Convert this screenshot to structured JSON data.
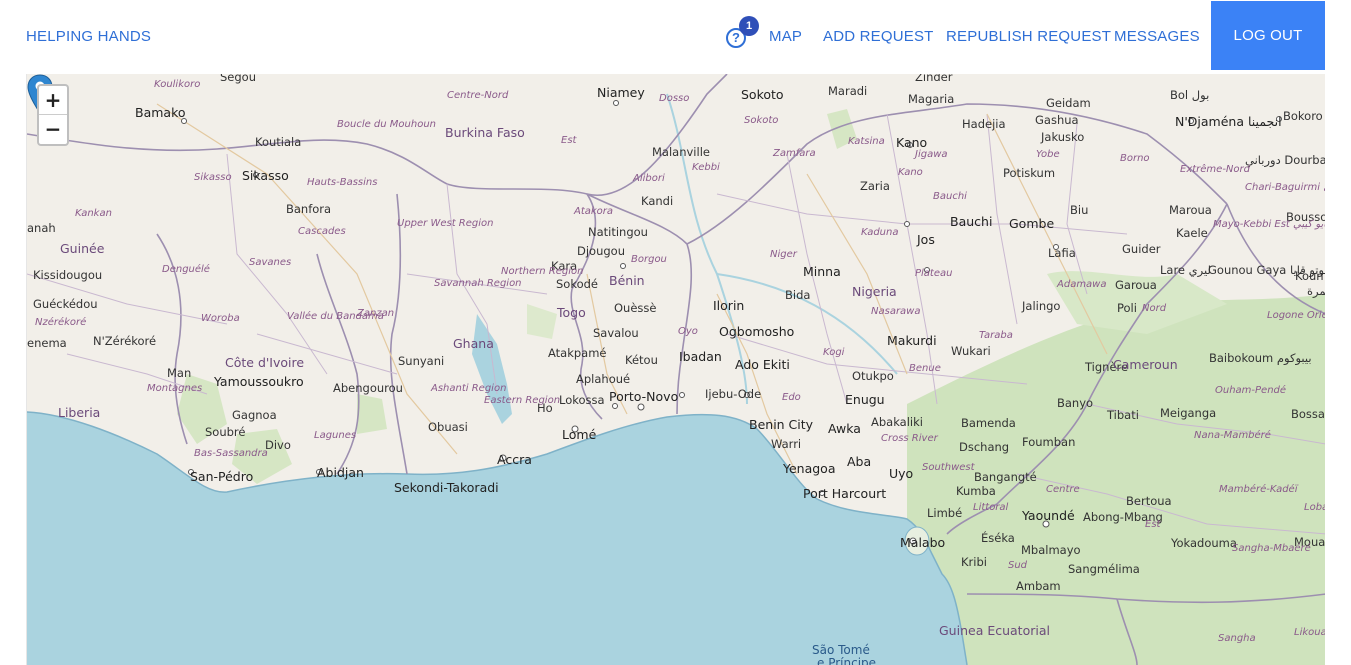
{
  "navbar": {
    "brand": "HELPING HANDS",
    "help_icon": "question-circle-icon",
    "notification_count": "1",
    "links": {
      "map": "MAP",
      "add_request": "ADD REQUEST",
      "republish_request": "REPUBLISH REQUEST",
      "messages": "MESSAGES"
    },
    "logout": "LOG OUT",
    "accent_color": "#3b82f6"
  },
  "map": {
    "zoom_in": "+",
    "zoom_out": "−",
    "marker_icon": "map-pin-icon",
    "labels": {
      "zinder": "Zinder",
      "segou": "Ségou",
      "koulikoro": "Koulikoro",
      "centre_nord": "Centre-Nord",
      "niamey": "Niamey",
      "dosso": "Dosso",
      "sokoto": "Sokoto",
      "maradi": "Maradi",
      "magaria": "Magaria",
      "geidam": "Geidam",
      "bol": "Bol بول",
      "bokoro": "Bokoro بوكورو",
      "ndjamena": "N'Djaména انجمينا",
      "bamako": "Bamako",
      "koutiala": "Koutiala",
      "boucle": "Boucle du Mouhoun",
      "burkina": "Burkina Faso",
      "est": "Est",
      "malanville": "Malanville",
      "sokoto_r": "Sokoto",
      "zamfara": "Zamfara",
      "katsina": "Katsina",
      "kano": "Kano",
      "hadejia": "Hadejia",
      "gashua": "Gashua",
      "jakusko": "Jakusko",
      "yobe": "Yobe",
      "borno": "Borno",
      "doulbali": "دورباني Dourbali",
      "kebbi": "Kebbi",
      "jigawa": "Jigawa",
      "potiskum": "Potiskum",
      "extreme_nord": "Extrême-Nord",
      "chari": "Chari-Baguirmi شاري باقرمي",
      "sikasso_r": "Sikasso",
      "sikasso": "Sikasso",
      "hauts_bassins": "Hauts-Bassins",
      "alibori": "Alibori",
      "kandi": "Kandi",
      "zaria": "Zaria",
      "kano_r": "Kano",
      "banfora": "Banfora",
      "cascades": "Cascades",
      "kankan": "Kankan",
      "upper_west": "Upper West Region",
      "atakora": "Atakora",
      "natitingou": "Natitingou",
      "bauchi_r": "Bauchi",
      "bauchi": "Bauchi",
      "gombe": "Gombe",
      "biu": "Biu",
      "maroua": "Maroua",
      "bousso": "Bousso بوسو",
      "guinee": "Guinée",
      "djougou": "Djougou",
      "borgou": "Borgou",
      "kaduna": "Kaduna",
      "jos": "Jos",
      "kaele": "Kaele",
      "mayo_kebbi": "Mayo-Kebbi Est مايو كيبي",
      "guider": "Guider",
      "savanes": "Savanes",
      "denguele": "Denguélé",
      "kara": "Kara",
      "northern": "Northern Region",
      "benin": "Bénin",
      "niger_r": "Niger",
      "minna": "Minna",
      "lafia": "Lafia",
      "lare": "Lare ليري",
      "gounou": "Gounou Gaya قوتو قايا",
      "kissidougou": "Kissidougou",
      "sokode": "Sokodé",
      "savannah": "Savannah Region",
      "plateau": "Plateau",
      "adamawa": "Adamawa",
      "garoua": "Garoua",
      "gueckedou": "Guéckédou",
      "bida": "Bida",
      "nigeria": "Nigeria",
      "ilorin": "Ilorin",
      "woroba": "Woroba",
      "zanzan": "Zanzan",
      "vallee": "Vallée du Bandama",
      "togo": "Togo",
      "ouesse": "Ouèssè",
      "nasarawa": "Nasarawa",
      "jalingo": "Jalingo",
      "poli": "Poli",
      "nord": "Nord",
      "logone": "Logone Oriental لوقون الشرقية",
      "nzerekore_r": "Nzérékoré",
      "nzerekore": "N'Zérékoré",
      "savalou": "Savalou",
      "oyo": "Oyo",
      "ogbomosho": "Ogbomosho",
      "makurdi": "Makurdi",
      "taraba": "Taraba",
      "wukari": "Wukari",
      "ghana": "Ghana",
      "atakpame": "Atakpamé",
      "ketou": "Kétou",
      "ibadan": "Ibadan",
      "cote": "Côte d'Ivoire",
      "sunyani": "Sunyani",
      "baibokoum": "Baibokoum بيبوكوم",
      "man": "Man",
      "kogi": "Kogi",
      "benue": "Benue",
      "tignere": "Tignère",
      "cameroun": "Cameroun",
      "ado_ekiti": "Ado Ekiti",
      "otukpo": "Otukpo",
      "yamoussoukro": "Yamoussoukro",
      "abengourou": "Abengourou",
      "aplahoue": "Aplahoué",
      "ouham": "Ouham-Pendé",
      "montagnes": "Montagnes",
      "ashanti": "Ashanti Region",
      "porto_novo": "Porto-Novo",
      "ijebu": "Ijebu-Ode",
      "edo": "Edo",
      "enugu": "Enugu",
      "banyo": "Banyo",
      "liberia": "Liberia",
      "lokossa": "Lokossa",
      "eastern": "Eastern Region",
      "ho": "Ho",
      "gagnoa": "Gagnoa",
      "meiganga": "Meiganga",
      "tibati": "Tibati",
      "bossangoa": "Bossang",
      "benin_city": "Benin City",
      "abakaliki": "Abakaliki",
      "obuasi": "Obuasi",
      "souble": "Soubré",
      "lagunes": "Lagunes",
      "awka": "Awka",
      "bamenda": "Bamenda",
      "lome": "Lomé",
      "cross_river": "Cross River",
      "nana": "Nana-Mambéré",
      "divo": "Divo",
      "warri": "Warri",
      "foumban": "Foumban",
      "dschang": "Dschang",
      "bas_sassandra": "Bas-Sassandra",
      "accra": "Accra",
      "aba": "Aba",
      "southwest": "Southwest",
      "san_pedro": "San-Pédro",
      "abidjan": "Abidjan",
      "yenagoa": "Yenagoa",
      "uyo": "Uyo",
      "bangangte": "Bangangté",
      "mambere": "Mambéré-Kadéï",
      "centre": "Centre",
      "sekondi": "Sekondi-Takoradi",
      "port_harcourt": "Port Harcourt",
      "kumba": "Kumba",
      "bertoua": "Bertoua",
      "lobo": "Loba",
      "limbe": "Limbé",
      "littoral": "Littoral",
      "yaounde": "Yaoundé",
      "abong": "Abong-Mbang",
      "est_cm": "Est",
      "malabo": "Malabo",
      "eseka": "Éséka",
      "yokadouma": "Yokadouma",
      "mouale": "Mouale",
      "kribi": "Kribi",
      "mbalmayo": "Mbalmayo",
      "sangha_mbaere": "Sangha-Mbaéré",
      "sud": "Sud",
      "sangmelima": "Sangmélima",
      "ambam": "Ambam",
      "guinea_ecuatorial": "Guinea Ecuatorial",
      "sangha": "Sangha",
      "likouala": "Likoual",
      "sao_tome": "São Tomé",
      "principe": "e Príncipe",
      "koun": "Koun",
      "nanah": "anah",
      "enema": "enema",
      "bamra": "بمرة"
    }
  }
}
